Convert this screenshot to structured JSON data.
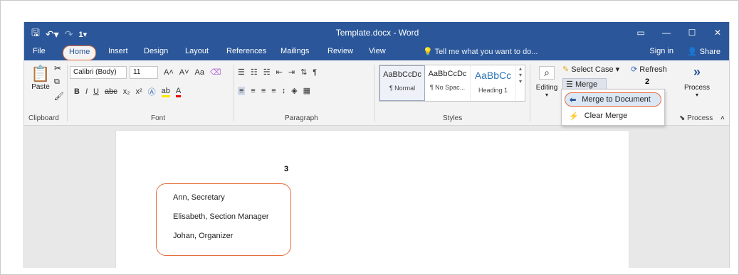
{
  "window": {
    "title": "Template.docx - Word",
    "qat": [
      "save-icon",
      "undo-icon",
      "redo-icon",
      "customize-icon"
    ],
    "qat_badge": "1",
    "controls": [
      "ribbon-display-icon",
      "minimize-icon",
      "maximize-icon",
      "close-icon"
    ]
  },
  "tabs": [
    "File",
    "Home",
    "Insert",
    "Design",
    "Layout",
    "References",
    "Mailings",
    "Review",
    "View"
  ],
  "active_tab": "Home",
  "tellme": "Tell me what you want to do...",
  "signin": "Sign in",
  "share": "Share",
  "clipboard": {
    "paste": "Paste",
    "label": "Clipboard"
  },
  "font": {
    "name": "Calibri (Body)",
    "size": "11",
    "label": "Font",
    "case": "Aa",
    "bold": "B",
    "italic": "I",
    "underline": "U",
    "strike": "abc",
    "subscript": "x₂",
    "superscript": "x²"
  },
  "paragraph": {
    "label": "Paragraph"
  },
  "styles": {
    "label": "Styles",
    "items": [
      {
        "sample": "AaBbCcDc",
        "name": "¶ Normal"
      },
      {
        "sample": "AaBbCcDc",
        "name": "¶ No Spac..."
      },
      {
        "sample": "AaBbCc",
        "name": "Heading 1"
      }
    ]
  },
  "editing": {
    "label": "Editing"
  },
  "merge": {
    "select_case": "Select Case",
    "merge": "Merge",
    "refresh": "Refresh",
    "menu": [
      "Merge to Document",
      "Clear Merge"
    ],
    "callout": "2"
  },
  "process": {
    "label": "Process",
    "group": "Process"
  },
  "document": {
    "callout": "3",
    "lines": [
      "Ann, Secretary",
      "Elisabeth, Section Manager",
      "Johan, Organizer"
    ]
  },
  "colors": {
    "title_blue": "#2b579a",
    "highlight": "#e36c3a"
  }
}
